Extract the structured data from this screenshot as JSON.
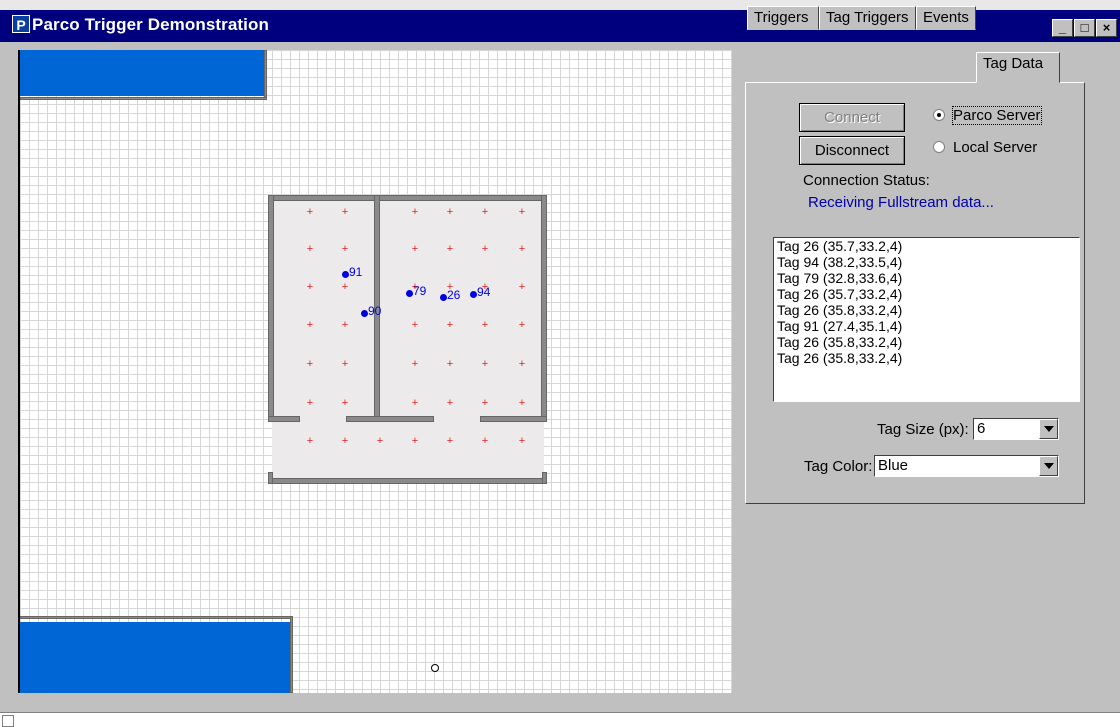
{
  "window": {
    "title": "Parco Trigger Demonstration",
    "app_icon_letter": "P"
  },
  "window_controls": {
    "minimize": "_",
    "maximize": "□",
    "close": "×"
  },
  "tabs": [
    {
      "label": "Triggers"
    },
    {
      "label": "Tag Triggers"
    },
    {
      "label": "Events"
    },
    {
      "label": "Tag Data"
    }
  ],
  "active_tab": "Tag Data",
  "tag_data": {
    "connect_label": "Connect",
    "disconnect_label": "Disconnect",
    "server_options": [
      {
        "label": "Parco Server",
        "selected": true
      },
      {
        "label": "Local Server",
        "selected": false
      }
    ],
    "connection_status_label": "Connection Status:",
    "connection_status_value": "Receiving Fullstream data...",
    "log": [
      "Tag 26 (35.7,33.2,4)",
      "Tag 94 (38.2,33.5,4)",
      "Tag 79 (32.8,33.6,4)",
      "Tag 26 (35.7,33.2,4)",
      "Tag 26 (35.8,33.2,4)",
      "Tag 91 (27.4,35.1,4)",
      "Tag 26 (35.8,33.2,4)",
      "Tag 26 (35.8,33.2,4)"
    ],
    "tag_size_label": "Tag Size (px):",
    "tag_size_value": "6",
    "tag_color_label": "Tag Color:",
    "tag_color_value": "Blue"
  },
  "map": {
    "tags": [
      {
        "id": "91"
      },
      {
        "id": "90"
      },
      {
        "id": "79"
      },
      {
        "id": "26"
      },
      {
        "id": "94"
      }
    ],
    "colors": {
      "tag": "#0000e0",
      "marker": "#e02020",
      "block": "#0066d6"
    }
  }
}
